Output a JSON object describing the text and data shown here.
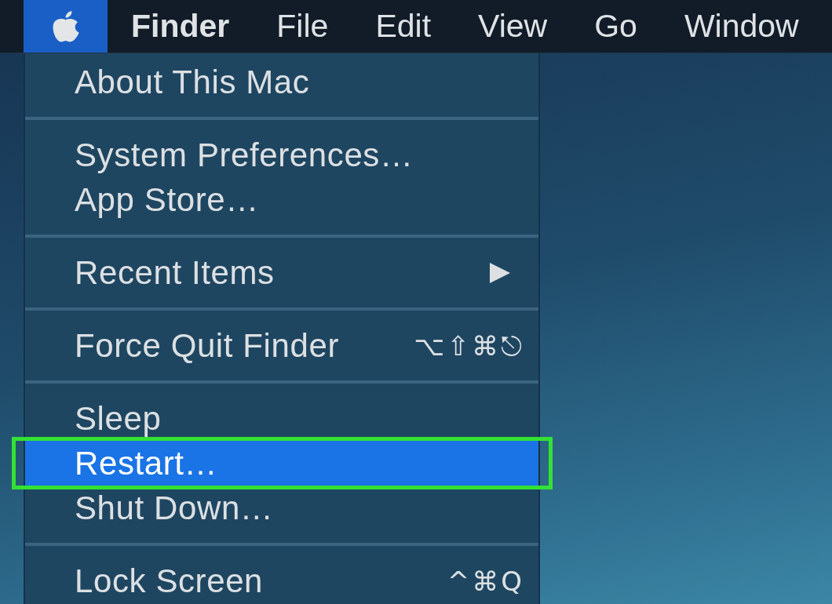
{
  "menu_bar": {
    "items": [
      {
        "kind": "logo",
        "selected": true
      },
      {
        "kind": "app",
        "label": "Finder",
        "selected": false
      },
      {
        "kind": "menu",
        "label": "File",
        "selected": false
      },
      {
        "kind": "menu",
        "label": "Edit",
        "selected": false
      },
      {
        "kind": "menu",
        "label": "View",
        "selected": false
      },
      {
        "kind": "menu",
        "label": "Go",
        "selected": false
      },
      {
        "kind": "menu",
        "label": "Window",
        "selected": false
      }
    ]
  },
  "apple_menu": {
    "groups": [
      [
        {
          "label": "About This Mac",
          "submenu": false,
          "selected": false,
          "annotated": false
        }
      ],
      [
        {
          "label": "System Preferences…",
          "submenu": false,
          "selected": false,
          "annotated": false
        },
        {
          "label": "App Store…",
          "submenu": false,
          "selected": false,
          "annotated": false
        }
      ],
      [
        {
          "label": "Recent Items",
          "submenu": true,
          "selected": false,
          "annotated": false
        }
      ],
      [
        {
          "label": "Force Quit Finder",
          "shortcut": "⌥⇧⌘⎋",
          "submenu": false,
          "selected": false,
          "annotated": false
        }
      ],
      [
        {
          "label": "Sleep",
          "submenu": false,
          "selected": false,
          "annotated": false
        },
        {
          "label": "Restart…",
          "submenu": false,
          "selected": true,
          "annotated": true
        },
        {
          "label": "Shut Down…",
          "submenu": false,
          "selected": false,
          "annotated": false
        }
      ],
      [
        {
          "label": "Lock Screen",
          "shortcut": "^⌘Q",
          "submenu": false,
          "selected": false,
          "annotated": false
        }
      ]
    ]
  }
}
